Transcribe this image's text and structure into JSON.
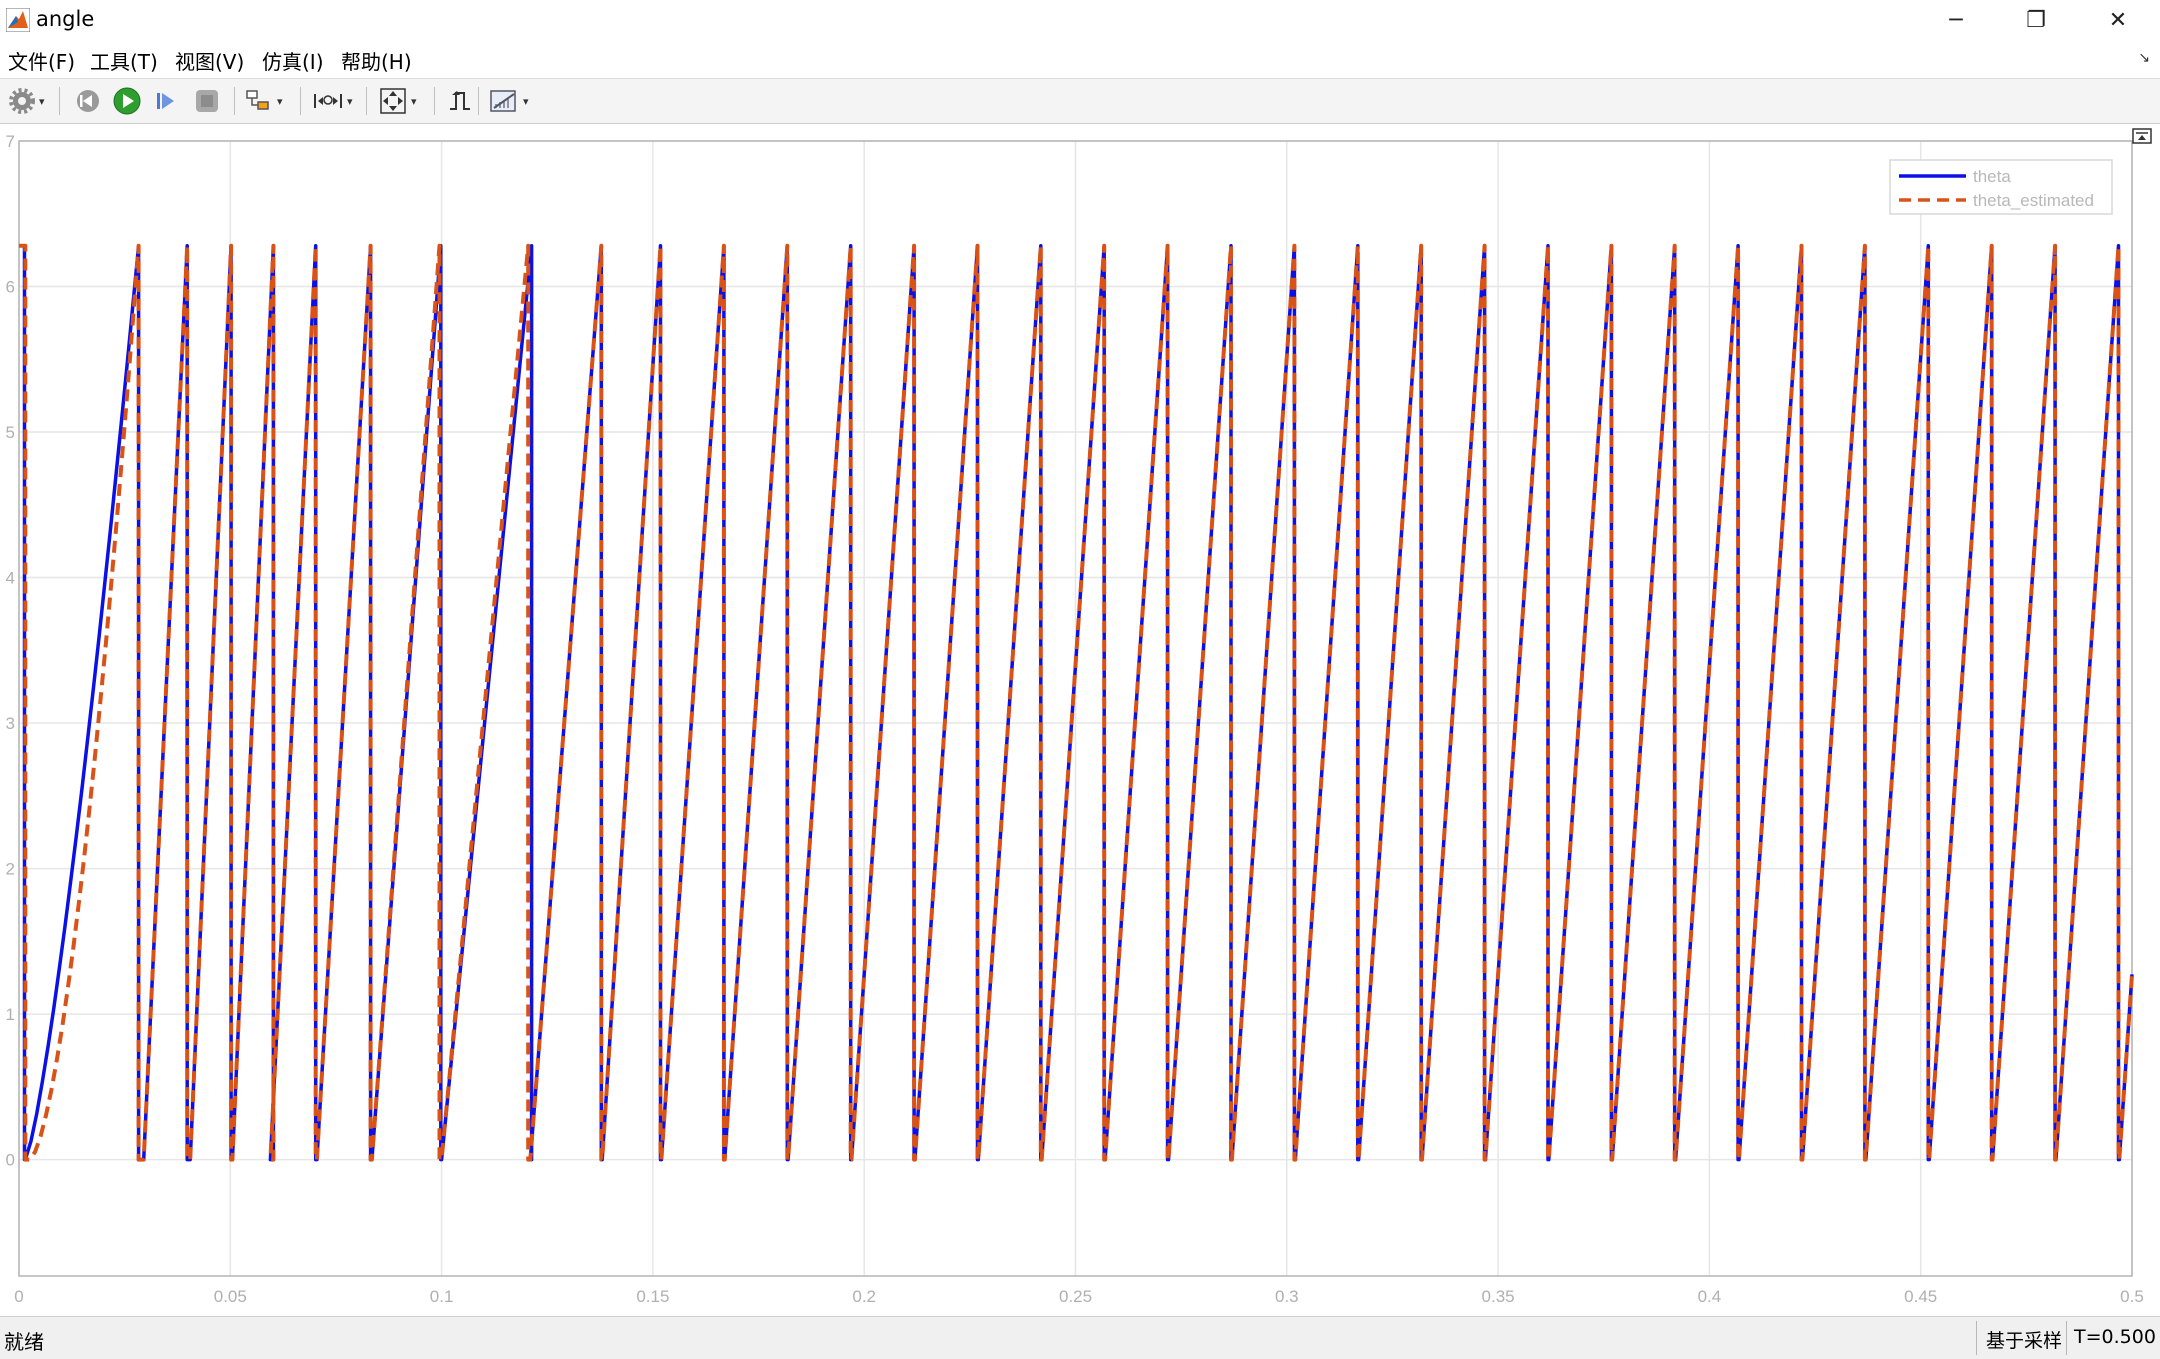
{
  "window": {
    "title": "angle",
    "minimize_glyph": "─",
    "maximize_glyph": "❐",
    "close_glyph": "✕"
  },
  "menu": {
    "items": [
      "文件(F)",
      "工具(T)",
      "视图(V)",
      "仿真(I)",
      "帮助(H)"
    ]
  },
  "toolbar": {
    "icons": [
      "gear-icon",
      "rewind-icon",
      "run-icon",
      "step-forward-icon",
      "stop-icon",
      "highlight-block-icon",
      "zoom-x-icon",
      "fit-to-view-icon",
      "triggers-icon",
      "measurements-icon"
    ]
  },
  "status": {
    "left": "就绪",
    "sample": "基于采样",
    "time": "T=0.500"
  },
  "colors": {
    "theta": "#0a10e6",
    "theta_estimated": "#d95319",
    "grid": "#e6e6e6",
    "axis": "#b4b4b4"
  },
  "chart_data": {
    "type": "line",
    "title": "",
    "xlabel": "",
    "ylabel": "",
    "xlim": [
      0,
      0.5
    ],
    "ylim": [
      -0.8,
      7
    ],
    "grid": true,
    "legend_position": "top-right",
    "x_ticks": [
      "0",
      "0.05",
      "0.1",
      "0.15",
      "0.2",
      "0.25",
      "0.3",
      "0.35",
      "0.4",
      "0.45",
      "0.5"
    ],
    "y_ticks": [
      "0",
      "1",
      "2",
      "3",
      "4",
      "5",
      "6",
      "7"
    ],
    "peak_value": 6.28,
    "series": [
      {
        "name": "theta",
        "style": "solid",
        "ramp_start_times": [
          0.0015,
          0.0295,
          0.0405,
          0.0505,
          0.0595,
          0.0705,
          0.0835,
          0.1,
          0.121,
          0.138,
          0.152,
          0.167,
          0.182,
          0.197,
          0.212,
          0.227,
          0.242,
          0.257,
          0.272,
          0.287,
          0.302,
          0.317,
          0.332,
          0.347,
          0.362,
          0.377,
          0.392,
          0.407,
          0.422,
          0.437,
          0.452,
          0.467,
          0.482,
          0.497
        ],
        "wrap_times": [
          0.0013,
          0.0283,
          0.0398,
          0.0502,
          0.0602,
          0.0702,
          0.0832,
          0.0998,
          0.1213,
          0.1378,
          0.1518,
          0.1668,
          0.1818,
          0.1968,
          0.2118,
          0.2268,
          0.2418,
          0.2568,
          0.2718,
          0.2868,
          0.3018,
          0.3168,
          0.3318,
          0.3468,
          0.3618,
          0.3768,
          0.3918,
          0.4068,
          0.4218,
          0.4368,
          0.4518,
          0.4668,
          0.4818,
          0.4968
        ]
      },
      {
        "name": "theta_estimated",
        "style": "dashed",
        "ramp_start_times": [
          0.0025,
          0.0295,
          0.0405,
          0.0505,
          0.0595,
          0.0705,
          0.0835,
          0.1,
          0.121,
          0.138,
          0.152,
          0.167,
          0.182,
          0.197,
          0.212,
          0.227,
          0.242,
          0.257,
          0.272,
          0.287,
          0.302,
          0.317,
          0.332,
          0.347,
          0.362,
          0.377,
          0.392,
          0.407,
          0.422,
          0.437,
          0.452,
          0.467,
          0.482,
          0.497
        ],
        "wrap_times": [
          0.0015,
          0.0283,
          0.0398,
          0.0502,
          0.0602,
          0.0702,
          0.0832,
          0.0995,
          0.1205,
          0.1378,
          0.1518,
          0.1668,
          0.1818,
          0.1968,
          0.2118,
          0.2268,
          0.2418,
          0.2568,
          0.2718,
          0.2868,
          0.3018,
          0.3168,
          0.3318,
          0.3468,
          0.3618,
          0.3768,
          0.3918,
          0.4068,
          0.4218,
          0.4368,
          0.4518,
          0.4668,
          0.4818,
          0.4968
        ]
      }
    ]
  }
}
